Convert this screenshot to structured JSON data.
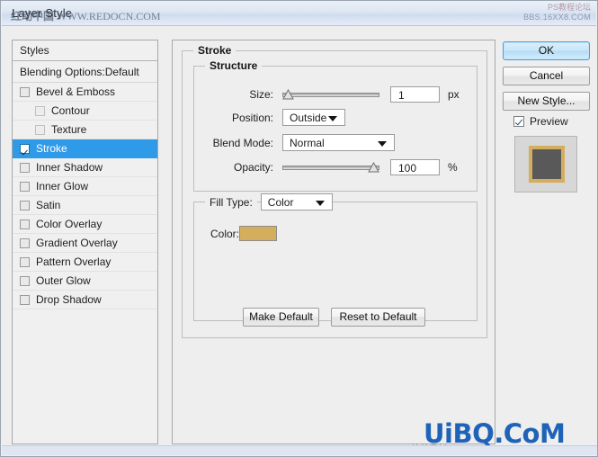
{
  "window": {
    "title": "Layer Style",
    "watermark_title_cn": "红动中国",
    "watermark_title_url": "WWW.REDOCN.COM",
    "watermark_topright_1": "PS教程论坛",
    "watermark_topright_2": "BBS.16XX8.COM",
    "watermark_bottom": "UiBQ.CoM",
    "watermark_bottom_sub": "站长素材 www.sccnn.com"
  },
  "styles_panel": {
    "header": "Styles",
    "blending_options": "Blending Options:Default",
    "effects": [
      {
        "label": "Bevel & Emboss",
        "checked": false,
        "indent": false,
        "selected": false
      },
      {
        "label": "Contour",
        "checked": false,
        "indent": true,
        "selected": false
      },
      {
        "label": "Texture",
        "checked": false,
        "indent": true,
        "selected": false
      },
      {
        "label": "Stroke",
        "checked": true,
        "indent": false,
        "selected": true
      },
      {
        "label": "Inner Shadow",
        "checked": false,
        "indent": false,
        "selected": false
      },
      {
        "label": "Inner Glow",
        "checked": false,
        "indent": false,
        "selected": false
      },
      {
        "label": "Satin",
        "checked": false,
        "indent": false,
        "selected": false
      },
      {
        "label": "Color Overlay",
        "checked": false,
        "indent": false,
        "selected": false
      },
      {
        "label": "Gradient Overlay",
        "checked": false,
        "indent": false,
        "selected": false
      },
      {
        "label": "Pattern Overlay",
        "checked": false,
        "indent": false,
        "selected": false
      },
      {
        "label": "Outer Glow",
        "checked": false,
        "indent": false,
        "selected": false
      },
      {
        "label": "Drop Shadow",
        "checked": false,
        "indent": false,
        "selected": false
      }
    ]
  },
  "stroke": {
    "group_label": "Stroke",
    "structure": {
      "group_label": "Structure",
      "size_label": "Size:",
      "size_value": "1",
      "size_unit": "px",
      "size_slider_percent": 0,
      "position_label": "Position:",
      "position_value": "Outside",
      "blend_mode_label": "Blend Mode:",
      "blend_mode_value": "Normal",
      "opacity_label": "Opacity:",
      "opacity_value": "100",
      "opacity_unit": "%",
      "opacity_slider_percent": 100
    },
    "fill": {
      "fill_type_label": "Fill Type:",
      "fill_type_value": "Color",
      "color_label": "Color:",
      "color_value": "#d4ae5c"
    },
    "make_default": "Make Default",
    "reset_to_default": "Reset to Default"
  },
  "buttons": {
    "ok": "OK",
    "cancel": "Cancel",
    "new_style": "New Style...",
    "preview_label": "Preview",
    "preview_checked": true
  },
  "preview_thumb": {
    "fill_color": "#595959",
    "stroke_color": "#d4ae5c"
  },
  "colors": {
    "selection_blue": "#2f9ae8",
    "titlebar_blue": "#dbe5f2",
    "panel_bg": "#eeeeee",
    "accent_link": "#1f63b8"
  }
}
